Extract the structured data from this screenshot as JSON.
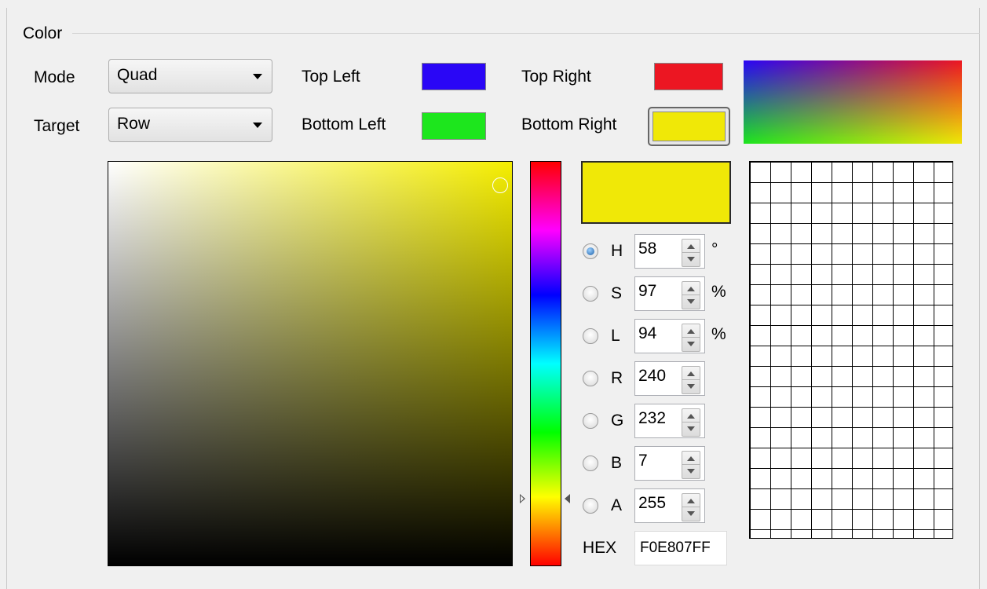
{
  "group": {
    "title": "Color"
  },
  "mode": {
    "label": "Mode",
    "value": "Quad"
  },
  "target": {
    "label": "Target",
    "value": "Row"
  },
  "corners": {
    "top_left": {
      "label": "Top Left",
      "color": "#2a06f6"
    },
    "top_right": {
      "label": "Top Right",
      "color": "#ec1622"
    },
    "bottom_left": {
      "label": "Bottom Left",
      "color": "#1de61d"
    },
    "bottom_right": {
      "label": "Bottom Right",
      "color": "#f0e807"
    }
  },
  "current_color": "#f0e807",
  "channels": [
    {
      "key": "H",
      "value": "58",
      "unit": "°",
      "selected": true
    },
    {
      "key": "S",
      "value": "97",
      "unit": "%",
      "selected": false
    },
    {
      "key": "L",
      "value": "94",
      "unit": "%",
      "selected": false
    },
    {
      "key": "R",
      "value": "240",
      "unit": "",
      "selected": false
    },
    {
      "key": "G",
      "value": "232",
      "unit": "",
      "selected": false
    },
    {
      "key": "B",
      "value": "7",
      "unit": "",
      "selected": false
    },
    {
      "key": "A",
      "value": "255",
      "unit": "",
      "selected": false
    }
  ],
  "hex": {
    "label": "HEX",
    "value": "F0E807FF"
  },
  "hue_position": 0.84,
  "sv_saturation": 0.97,
  "sv_value": 0.94
}
